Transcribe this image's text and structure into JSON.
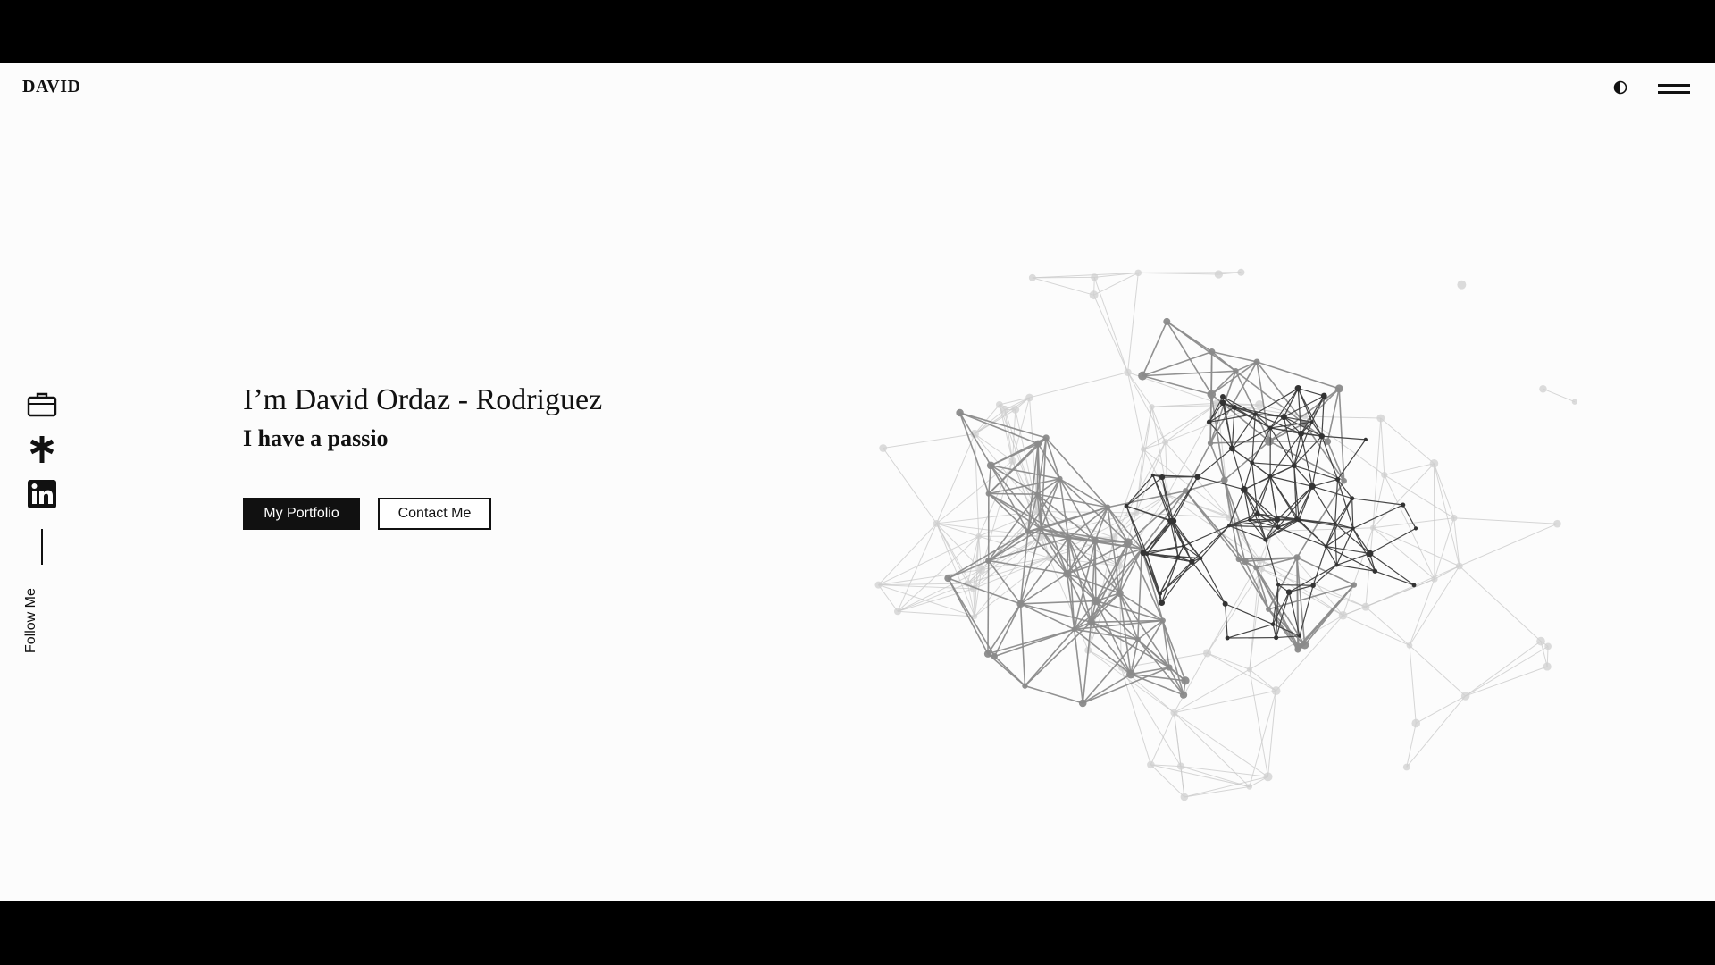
{
  "header": {
    "logo": "DAVID",
    "theme_toggle_icon": "contrast-icon",
    "menu_icon": "hamburger-menu-icon"
  },
  "sidebar": {
    "social_links": [
      {
        "name": "portfolio",
        "icon": "briefcase-icon"
      },
      {
        "name": "linktree",
        "icon": "asterisk-icon"
      },
      {
        "name": "linkedin",
        "icon": "linkedin-icon"
      }
    ],
    "follow_label": "Follow Me"
  },
  "hero": {
    "title": "I’m David Ordaz - Rodriguez",
    "subtitle": "I have a passio",
    "primary_button": "My Portfolio",
    "secondary_button": "Contact Me"
  },
  "colors": {
    "background": "#fcfcfc",
    "text": "#111111",
    "letterbox": "#000000"
  },
  "decoration": {
    "illustration": "network-graph"
  }
}
